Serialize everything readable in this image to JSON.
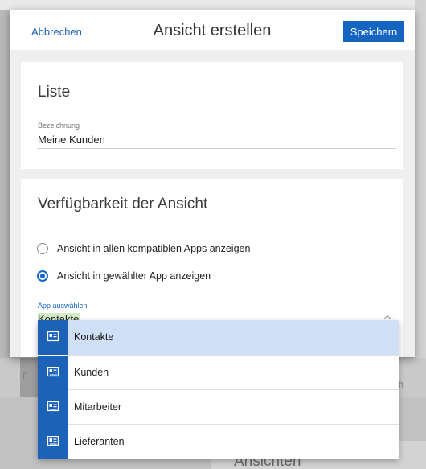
{
  "background": {
    "partial_text_left": "F",
    "partial_text_right": "ft",
    "heading_partial": "Ansichten"
  },
  "dialog": {
    "cancel_label": "Abbrechen",
    "title": "Ansicht erstellen",
    "save_label": "Speichern"
  },
  "list_section": {
    "title": "Liste",
    "name_label": "Bezeichnung",
    "name_value": "Meine Kunden"
  },
  "availability_section": {
    "title": "Verfügbarkeit der Ansicht",
    "option_all": "Ansicht in allen kompatiblen Apps anzeigen",
    "option_selected_app": "Ansicht in gewählter App anzeigen",
    "selected_option": "option_selected_app",
    "app_label": "App auswählen",
    "app_value": "Kontakte"
  },
  "dropdown": {
    "items": [
      {
        "label": "Kontakte",
        "icon": "contact-card-icon",
        "selected": true
      },
      {
        "label": "Kunden",
        "icon": "contact-card-icon",
        "selected": false
      },
      {
        "label": "Mitarbeiter",
        "icon": "contact-card-icon",
        "selected": false
      },
      {
        "label": "Lieferanten",
        "icon": "contact-card-icon",
        "selected": false
      }
    ]
  },
  "colors": {
    "accent": "#1565c0",
    "highlight": "#cfe0f6",
    "value_highlight": "#d4ecc7"
  }
}
